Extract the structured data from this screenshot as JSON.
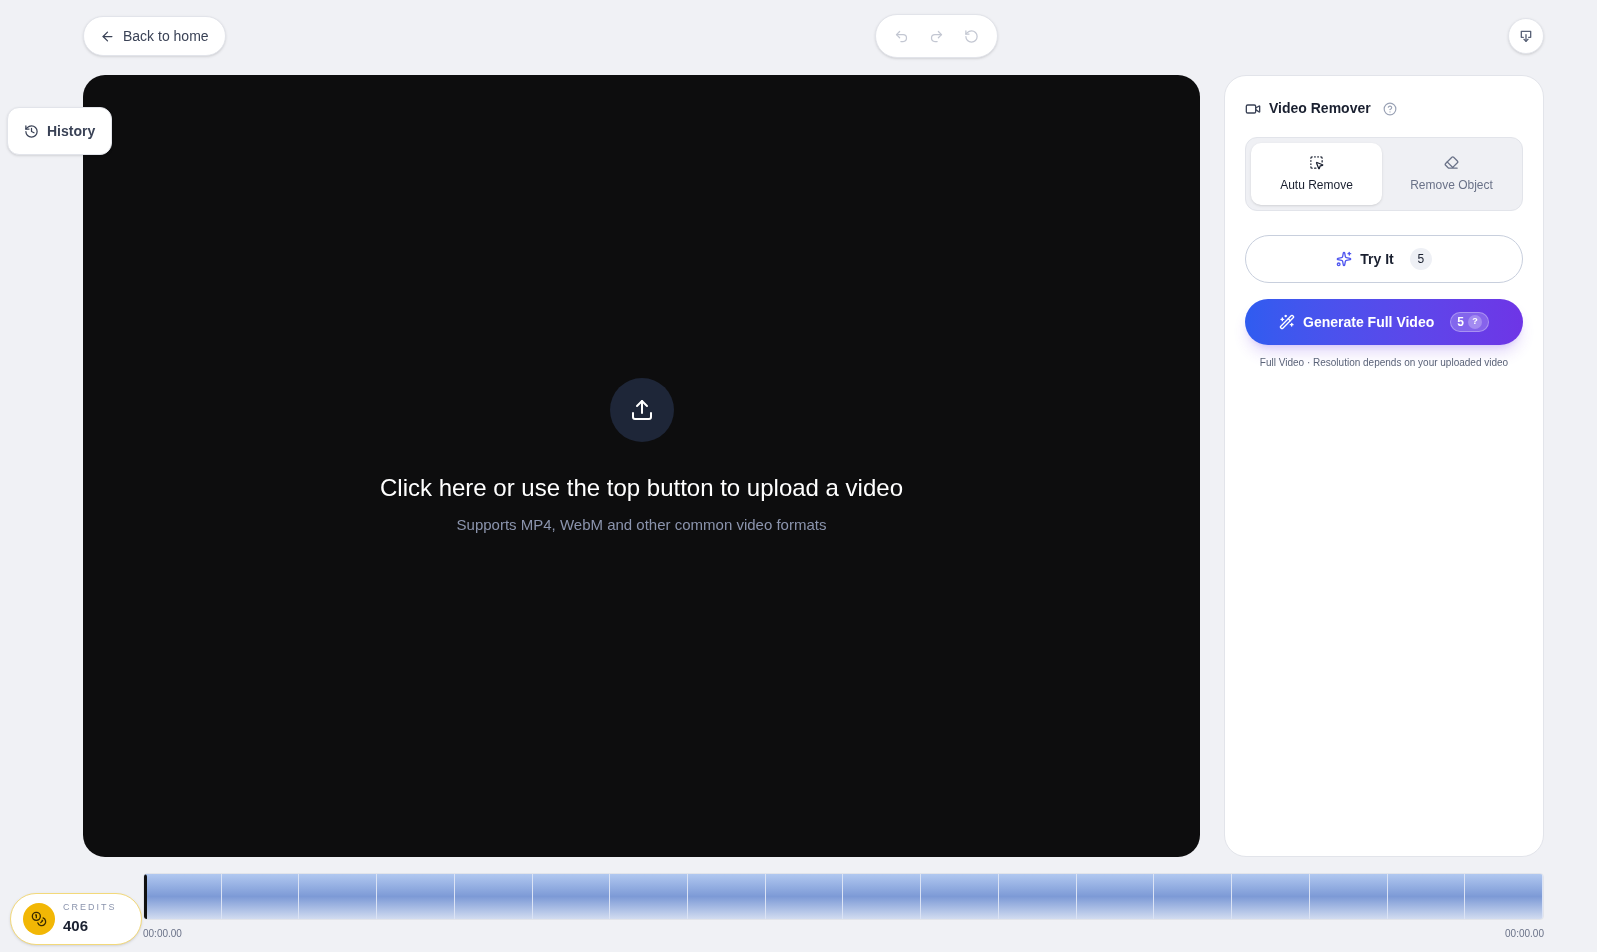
{
  "top_bar": {
    "back_button": "Back to home",
    "tools": [
      {
        "kind": "undo",
        "disabled": true
      },
      {
        "kind": "redo",
        "disabled": true
      },
      {
        "kind": "reset",
        "disabled": true
      }
    ]
  },
  "history_button": "History",
  "upload": {
    "title": "Click here or use the top button to upload a video",
    "subtitle": "Supports MP4, WebM and other common video formats"
  },
  "panel": {
    "title": "Video Remover",
    "modes": [
      {
        "kind": "auto",
        "label": "Autu Remove",
        "selected": true
      },
      {
        "kind": "object",
        "label": "Remove Object",
        "selected": false
      }
    ],
    "try_button": {
      "label": "Try It",
      "count": "5"
    },
    "generate_button": {
      "label": "Generate Full Video",
      "count": "5",
      "help": "?"
    },
    "note": "Full Video · Resolution depends on your uploaded video"
  },
  "timeline": {
    "start_time": "00:00.00",
    "end_time": "00:00.00"
  },
  "credits": {
    "label": "CREDITS",
    "value": "406"
  }
}
